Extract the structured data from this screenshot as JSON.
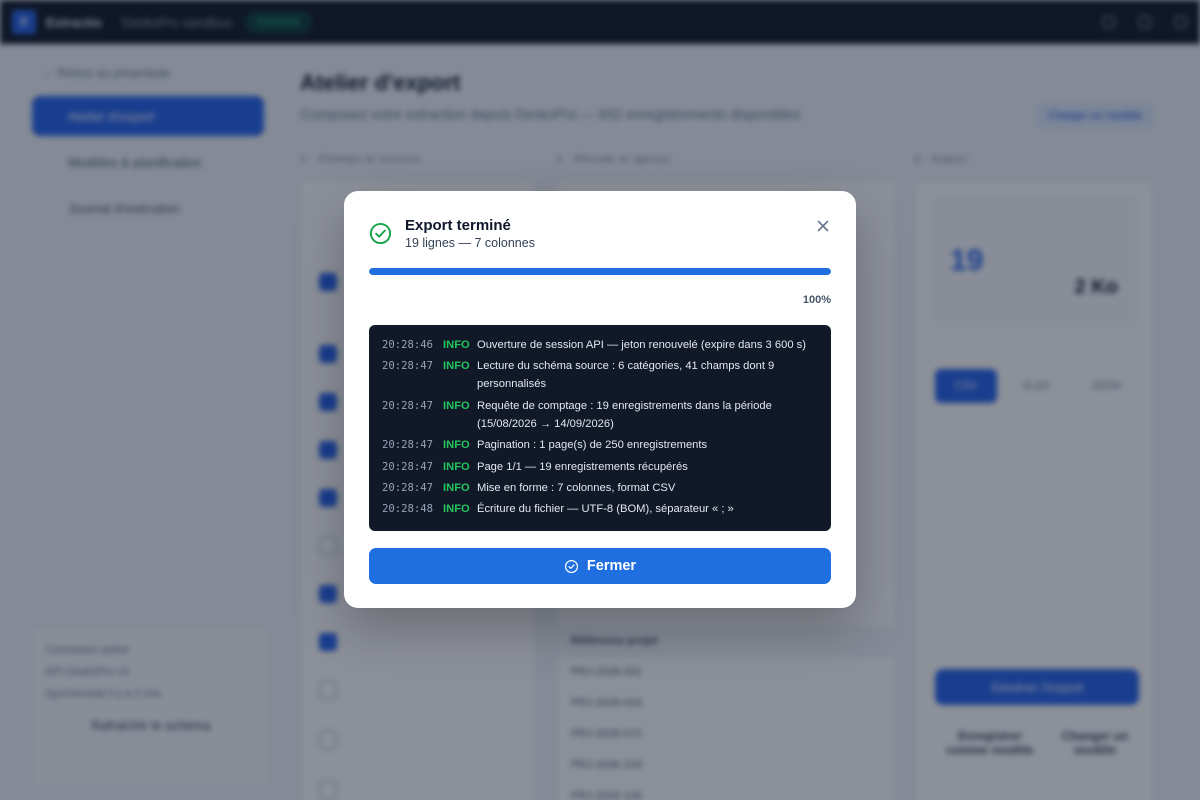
{
  "app": {
    "brand": "Extractio",
    "subtitle": "DeskoPro sandbox",
    "status_pill": "Connecté",
    "back_link": "← Retour au préambule",
    "nav": [
      {
        "label": "Atelier d'export"
      },
      {
        "label": "Modèles & planification"
      },
      {
        "label": "Journal d'exécution"
      }
    ],
    "footer_title": "Connexion active",
    "footer_lines": [
      "API DeskoPro v3",
      "Synchronisé il y a 2 min"
    ],
    "refresh_label": "Rafraîchir le schéma",
    "page_title": "Atelier d'export",
    "page_subtitle": "Composez votre extraction depuis DeskoPro — 842 enregistrements disponibles",
    "header_button": "Charger un modèle",
    "columns": [
      "1 · Champs et sources",
      "2 · Période et aperçu",
      "3 · Export"
    ],
    "preview_rows": [
      "PRJ-2026-001",
      "PRJ-2026-019",
      "PRJ-2026-072",
      "PRJ-2026-103",
      "PRJ-2026-118"
    ],
    "summary_count": "19",
    "summary_size": "2 Ko",
    "formats": [
      "CSV",
      "XLSX",
      "JSON"
    ],
    "export_button": "Générer l'export",
    "save_label": "Enregistrer comme modèle",
    "plan_label": "Changer un modèle"
  },
  "modal": {
    "title": "Export terminé",
    "subtitle": "19 lignes — 7 colonnes",
    "progress_label": "100%",
    "progress_value": 1.0,
    "log": [
      {
        "time": "20:28:46",
        "level": "INFO",
        "message": "Ouverture de session API — jeton renouvelé (expire dans 3 600 s)"
      },
      {
        "time": "20:28:47",
        "level": "INFO",
        "message": "Lecture du schéma source : 6 catégories, 41 champs dont 9 personnalisés"
      },
      {
        "time": "20:28:47",
        "level": "INFO",
        "message": "Requête de comptage : 19 enregistrements dans la période (15/08/2026 → 14/09/2026)"
      },
      {
        "time": "20:28:47",
        "level": "INFO",
        "message": "Pagination : 1 page(s) de 250 enregistrements"
      },
      {
        "time": "20:28:47",
        "level": "INFO",
        "message": "Page 1/1 — 19 enregistrements récupérés"
      },
      {
        "time": "20:28:47",
        "level": "INFO",
        "message": "Mise en forme : 7 colonnes, format CSV"
      },
      {
        "time": "20:28:48",
        "level": "INFO",
        "message": "Écriture du fichier — UTF-8 (BOM), séparateur « ; »"
      }
    ],
    "button_label": "Fermer",
    "colors": {
      "accent": "#1f6fe0",
      "success": "#16a34a",
      "log_bg": "#111827"
    }
  }
}
